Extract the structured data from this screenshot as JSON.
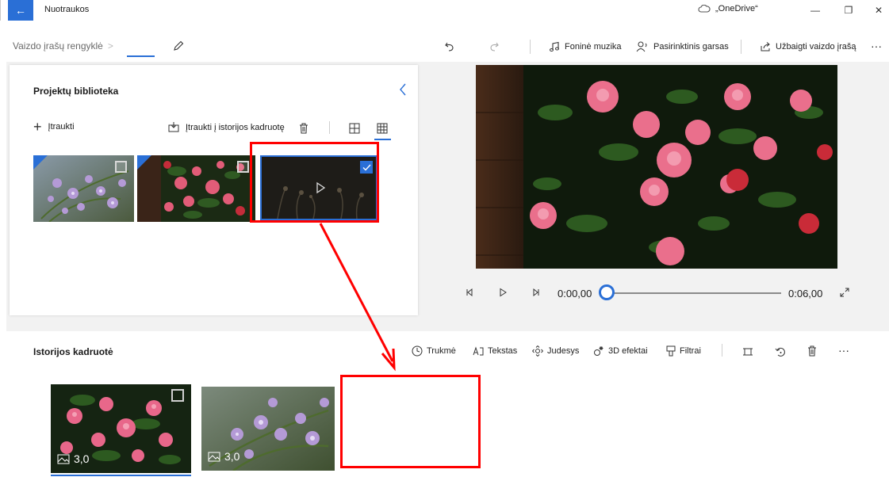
{
  "titlebar": {
    "back_glyph": "←",
    "app_title": "Nuotraukos",
    "onedrive_label": "„OneDrive“",
    "minimize_glyph": "—",
    "maximize_glyph": "❐",
    "close_glyph": "✕"
  },
  "toolbar": {
    "breadcrumb": "Vaizdo įrašų rengyklė",
    "breadcrumb_sep": ">",
    "background_music": "Foninė muzika",
    "custom_audio": "Pasirinktinis garsas",
    "finish_video": "Užbaigti vaizdo įrašą",
    "more": "···"
  },
  "library": {
    "title": "Projektų biblioteka",
    "add_label": "Įtraukti",
    "add_to_storyboard": "Įtraukti į istorijos kadruotę",
    "items": [
      {
        "name": "purple-flowers-photo",
        "selected": false,
        "in_storyboard": true
      },
      {
        "name": "red-roses-photo",
        "selected": false,
        "in_storyboard": true
      },
      {
        "name": "dark-video-clip",
        "selected": true,
        "in_storyboard": false
      }
    ]
  },
  "player": {
    "time_current": "0:00,00",
    "time_total": "0:06,00",
    "progress": 0
  },
  "storyboard": {
    "title": "Istorijos kadruotė",
    "tools": {
      "duration": "Trukmė",
      "text": "Tekstas",
      "motion": "Judesys",
      "effects3d": "3D efektai",
      "filters": "Filtrai",
      "more": "···"
    },
    "clips": [
      {
        "duration": "3,0",
        "kind": "roses"
      },
      {
        "duration": "3,0",
        "kind": "purple-flowers"
      }
    ]
  },
  "colors": {
    "accent": "#2a6fd6",
    "annotation": "#ff0000"
  }
}
